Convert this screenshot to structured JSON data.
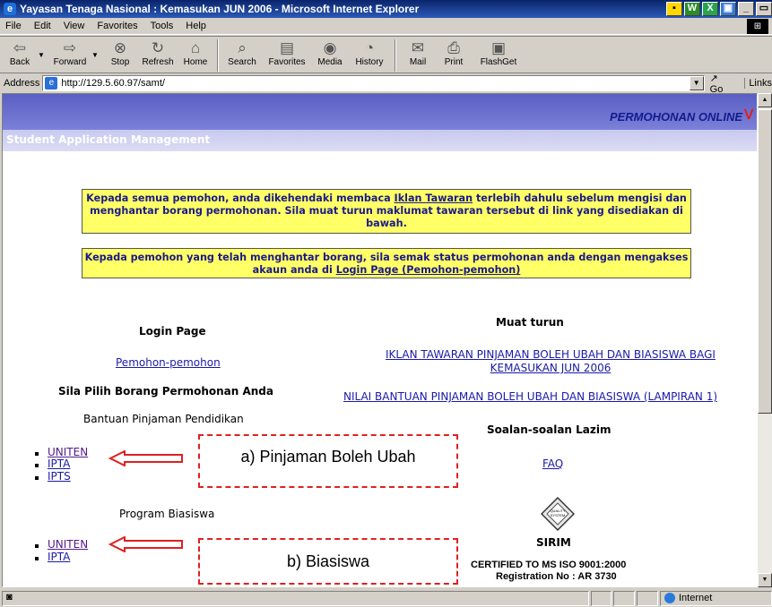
{
  "window": {
    "title": "Yayasan Tenaga Nasional : Kemasukan JUN 2006 - Microsoft Internet Explorer"
  },
  "menu": [
    "File",
    "Edit",
    "View",
    "Favorites",
    "Tools",
    "Help"
  ],
  "toolbar": {
    "back": "Back",
    "forward": "Forward",
    "stop": "Stop",
    "refresh": "Refresh",
    "home": "Home",
    "search": "Search",
    "favorites": "Favorites",
    "media": "Media",
    "history": "History",
    "mail": "Mail",
    "print": "Print",
    "flashget": "FlashGet"
  },
  "address": {
    "label": "Address",
    "url": "http://129.5.60.97/samt/",
    "go": "Go",
    "links": "Links"
  },
  "page": {
    "banner_right": "PERMOHONAN ONLINE",
    "banner_sub": "Student Application Management",
    "notice1": {
      "before": "Kepada semua pemohon, anda dikehendaki membaca ",
      "link": "Iklan Tawaran",
      "after": " terlebih dahulu sebelum mengisi dan menghantar borang permohonan. Sila muat turun maklumat tawaran tersebut di link yang disediakan di bawah."
    },
    "notice2": {
      "before": "Kepada pemohon yang telah menghantar borang, sila semak status permohonan anda dengan mengakses akaun anda di ",
      "link": "Login Page (Pemohon-pemohon)"
    },
    "login_heading": "Login Page",
    "login_link": "Pemohon-pemohon",
    "choose_heading": "Sila Pilih Borang Permohonan Anda",
    "section1_title": "Bantuan Pinjaman Pendidikan",
    "section1_items": [
      "UNITEN",
      "IPTA",
      "IPTS"
    ],
    "section2_title": "Program Biasiswa",
    "section2_items": [
      "UNITEN",
      "IPTA"
    ],
    "annot1": "a) Pinjaman Boleh Ubah",
    "annot2": "b) Biasiswa",
    "download_heading": "Muat turun",
    "download_link1": "IKLAN TAWARAN PINJAMAN BOLEH UBAH DAN BIASISWA BAGI KEMASUKAN JUN 2006",
    "download_link2": "NILAI BANTUAN PINJAMAN BOLEH UBAH DAN BIASISWA (LAMPIRAN 1)",
    "faq_heading": "Soalan-soalan Lazim",
    "faq_link": "FAQ",
    "quality_text": "QUALITY SYSTEM",
    "sirim": "SIRIM",
    "certified": "CERTIFIED TO MS ISO 9001:2000",
    "registration": "Registration No : AR 3730"
  },
  "status": {
    "zone": "Internet"
  },
  "colors": {
    "annotation": "#e02020",
    "notice_bg": "#ffff66",
    "link": "#1a1aa8"
  }
}
